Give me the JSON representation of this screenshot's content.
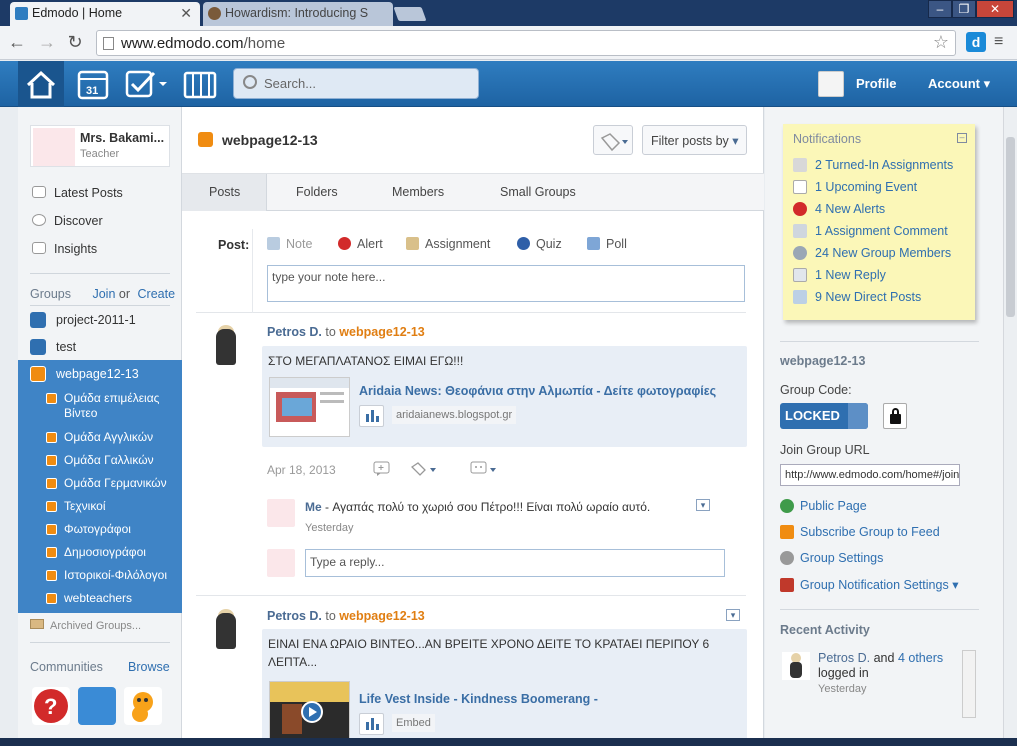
{
  "browser": {
    "tabs": [
      {
        "title": "Edmodo | Home",
        "active": true
      },
      {
        "title": "Howardism: Introducing S",
        "active": false
      }
    ],
    "url_host": "www.edmodo.com",
    "url_path": "/home"
  },
  "header": {
    "search_placeholder": "Search...",
    "profile_label": "Profile",
    "account_label": "Account"
  },
  "user": {
    "name": "Mrs. Bakami...",
    "role": "Teacher"
  },
  "left_nav": {
    "items": [
      "Latest Posts",
      "Discover",
      "Insights"
    ],
    "groups_label": "Groups",
    "join_label": "Join",
    "or_label": "or",
    "create_label": "Create",
    "groups": [
      {
        "name": "project-2011-1",
        "color": "#2f6fb0"
      },
      {
        "name": "test",
        "color": "#2f6fb0"
      },
      {
        "name": "webpage12-13",
        "color": "#f08c11"
      }
    ],
    "subgroups": [
      "Ομάδα επιμέλειας Βίντεο",
      "Ομάδα Αγγλικών",
      "Ομάδα Γαλλικών",
      "Ομάδα Γερμανικών",
      "Τεχνικοί",
      "Φωτογράφοι",
      "Δημοσιογράφοι",
      "Ιστορικοί-Φιλόλογοι",
      "webteachers"
    ],
    "archived_label": "Archived Groups...",
    "communities_label": "Communities",
    "browse_label": "Browse"
  },
  "main": {
    "group_title": "webpage12-13",
    "filter_label": "Filter posts by",
    "tabs": [
      "Posts",
      "Folders",
      "Members",
      "Small Groups"
    ],
    "post_label": "Post:",
    "post_types": [
      "Note",
      "Alert",
      "Assignment",
      "Quiz",
      "Poll"
    ],
    "note_placeholder": "type your note here...",
    "to_label": "to",
    "posts": [
      {
        "author": "Petros D.",
        "group": "webpage12-13",
        "text": "ΣΤΟ ΜΕΓΑΠΛΑΤΑΝΟΣ ΕΙΜΑΙ ΕΓΩ!!!",
        "link_title": "Aridaia News: Θεοφάνια στην Αλμωπία - Δείτε φωτογραφίες",
        "link_url": "aridaianews.blogspot.gr",
        "date": "Apr 18, 2013",
        "reply_author": "Me",
        "reply_text": " - Αγαπάς πολύ το χωριό σου Πέτρο!!! Είναι πολύ ωραίο αυτό.",
        "reply_date": "Yesterday",
        "reply_placeholder": "Type a reply..."
      },
      {
        "author": "Petros D.",
        "group": "webpage12-13",
        "text": "ΕΙΝΑΙ ΕΝΑ ΩΡΑΙΟ ΒΙΝΤΕΟ...ΑΝ ΒΡΕΙΤΕ ΧΡΟΝΟ ΔΕΙΤΕ ΤΟ ΚΡΑΤΑΕΙ ΠΕΡΙΠΟΥ 6 ΛΕΠΤΑ...",
        "link_title": "Life Vest Inside - Kindness Boomerang -",
        "link_url": "Embed"
      }
    ]
  },
  "notifications": {
    "title": "Notifications",
    "items": [
      "2 Turned-In Assignments",
      "1 Upcoming Event",
      "4 New Alerts",
      "1 Assignment Comment",
      "24 New Group Members",
      "1 New Reply",
      "9 New Direct Posts"
    ]
  },
  "group_info": {
    "title": "webpage12-13",
    "code_label": "Group Code:",
    "code_value": "LOCKED",
    "join_url_label": "Join Group URL",
    "join_url": "http://www.edmodo.com/home#/join",
    "links": [
      "Public Page",
      "Subscribe Group to Feed",
      "Group Settings",
      "Group Notification Settings"
    ],
    "recent_label": "Recent Activity",
    "activity_author": "Petros D.",
    "activity_and": "and",
    "activity_others": "4 others",
    "activity_text": "logged in",
    "activity_date": "Yesterday"
  },
  "colors": {
    "brand_blue": "#2f7dc0",
    "group_orange": "#f08c11",
    "notif_yellow": "#fbf7b8"
  }
}
